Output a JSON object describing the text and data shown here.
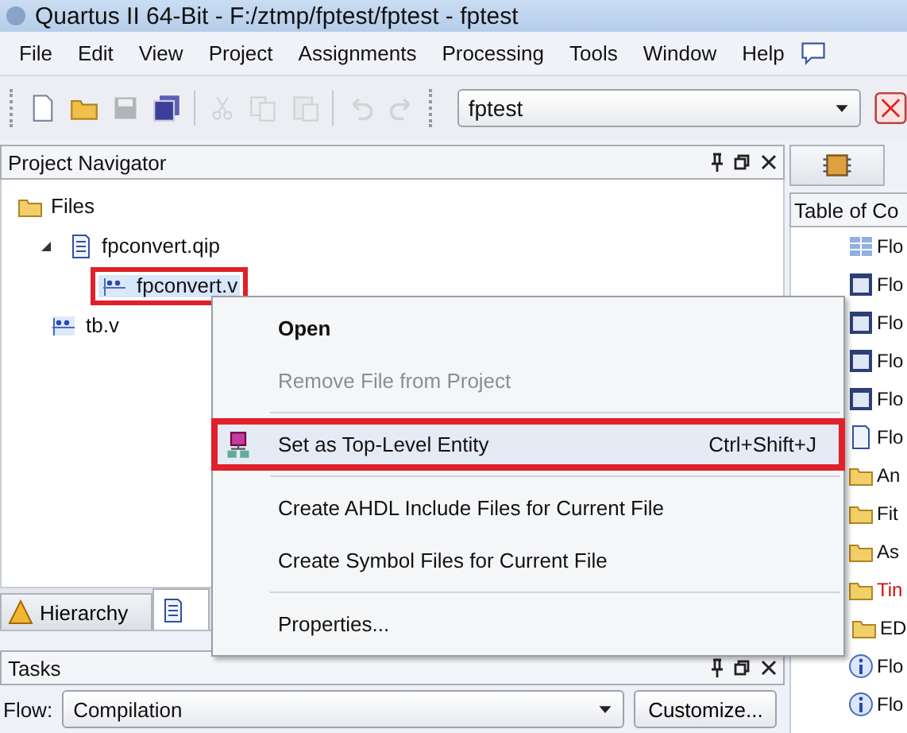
{
  "window": {
    "title": "Quartus II 64-Bit - F:/ztmp/fptest/fptest - fptest"
  },
  "menu": [
    "File",
    "Edit",
    "View",
    "Project",
    "Assignments",
    "Processing",
    "Tools",
    "Window",
    "Help"
  ],
  "toolbar": [
    {
      "kind": "new",
      "disabled": false
    },
    {
      "kind": "open",
      "disabled": false
    },
    {
      "kind": "save",
      "disabled": true
    },
    {
      "kind": "save-all",
      "disabled": false
    },
    {
      "kind": "sep"
    },
    {
      "kind": "cut",
      "disabled": true
    },
    {
      "kind": "copy",
      "disabled": true
    },
    {
      "kind": "paste",
      "disabled": true
    },
    {
      "kind": "sep"
    },
    {
      "kind": "undo",
      "disabled": true
    },
    {
      "kind": "redo",
      "disabled": true
    }
  ],
  "project_combo": {
    "value": "fptest"
  },
  "navigator": {
    "title": "Project Navigator",
    "tree": [
      {
        "label": "Files",
        "kind": "folder",
        "selected": false,
        "annotated": false,
        "children": [
          {
            "label": "fpconvert.qip",
            "kind": "qip",
            "selected": false,
            "annotated": false,
            "expanded": true,
            "children": [
              {
                "label": "fpconvert.v",
                "kind": "verilog",
                "selected": true,
                "annotated": true
              }
            ]
          },
          {
            "label": "tb.v",
            "kind": "verilog",
            "selected": false,
            "annotated": false
          }
        ]
      }
    ],
    "tabs": [
      {
        "label": "Hierarchy",
        "selected": false
      },
      {
        "selected": true
      }
    ]
  },
  "context_menu": [
    {
      "kind": "item",
      "label": "Open",
      "bold": true,
      "disabled": false,
      "highlighted": false,
      "annotated": false
    },
    {
      "kind": "item",
      "label": "Remove File from Project",
      "bold": false,
      "disabled": true,
      "highlighted": false,
      "annotated": false
    },
    {
      "kind": "sep"
    },
    {
      "kind": "item",
      "label": "Set as Top-Level Entity",
      "shortcut": "Ctrl+Shift+J",
      "icon": true,
      "bold": false,
      "disabled": false,
      "highlighted": true,
      "annotated": true
    },
    {
      "kind": "sep"
    },
    {
      "kind": "item",
      "label": "Create AHDL Include Files for Current File",
      "bold": false,
      "disabled": false,
      "highlighted": false,
      "annotated": false
    },
    {
      "kind": "item",
      "label": "Create Symbol Files for Current File",
      "bold": false,
      "disabled": false,
      "highlighted": false,
      "annotated": false
    },
    {
      "kind": "sep"
    },
    {
      "kind": "item",
      "label": "Properties...",
      "bold": false,
      "disabled": false,
      "highlighted": false,
      "annotated": false
    }
  ],
  "tasks": {
    "title": "Tasks",
    "flow_label": "Flow:",
    "flow_value": "Compilation",
    "customize": "Customize..."
  },
  "report": {
    "header": "Table of Co",
    "items": [
      {
        "label": "Flo",
        "kind": "table",
        "error": false,
        "expandable": false
      },
      {
        "label": "Flo",
        "kind": "form",
        "error": false,
        "expandable": false
      },
      {
        "label": "Flo",
        "kind": "form",
        "error": false,
        "expandable": false
      },
      {
        "label": "Flo",
        "kind": "form",
        "error": false,
        "expandable": false
      },
      {
        "label": "Flo",
        "kind": "form",
        "error": false,
        "expandable": false
      },
      {
        "label": "Flo",
        "kind": "doc",
        "error": false,
        "expandable": false
      },
      {
        "label": "An",
        "kind": "folder",
        "error": false,
        "expandable": false
      },
      {
        "label": "Fit",
        "kind": "folder",
        "error": false,
        "expandable": false
      },
      {
        "label": "As",
        "kind": "folder",
        "error": false,
        "expandable": false
      },
      {
        "label": "Tin",
        "kind": "folder",
        "error": true,
        "expandable": false
      },
      {
        "label": "ED",
        "kind": "folder",
        "error": false,
        "expandable": true
      },
      {
        "label": "Flo",
        "kind": "info",
        "error": false,
        "expandable": false
      },
      {
        "label": "Flo",
        "kind": "info",
        "error": false,
        "expandable": false
      }
    ]
  }
}
